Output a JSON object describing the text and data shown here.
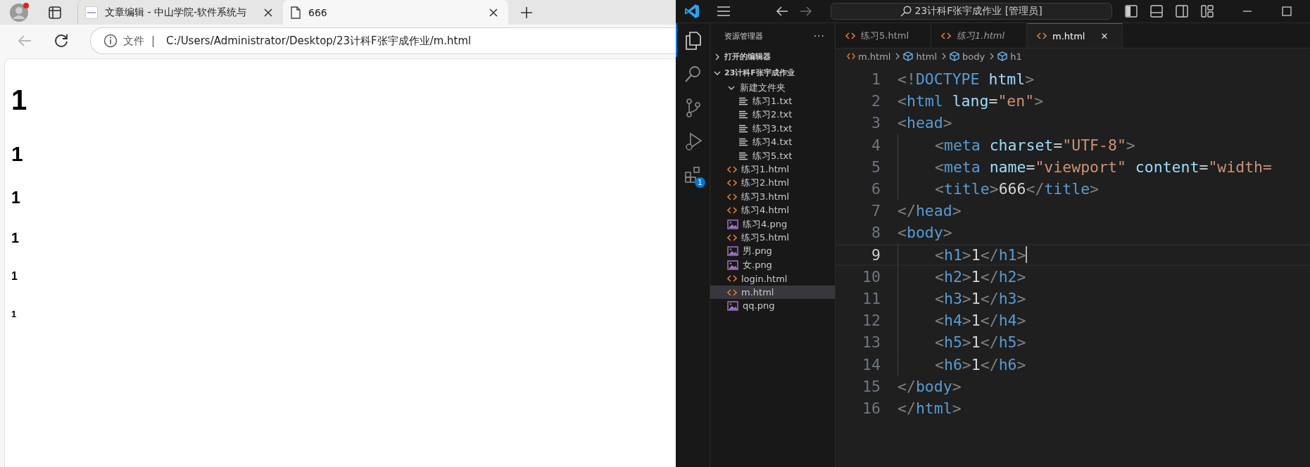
{
  "browser": {
    "tabs": [
      {
        "title": "文章编辑 - 中山学院-软件系统与",
        "kind": "site",
        "selected": false
      },
      {
        "title": "666",
        "kind": "file",
        "selected": true
      }
    ],
    "address": {
      "scheme_label": "文件",
      "separator": "|",
      "url": "C:/Users/Administrator/Desktop/23计科F张宇成作业/m.html"
    },
    "headings": [
      {
        "kind": "h1",
        "text": "1"
      },
      {
        "kind": "h2",
        "text": "1"
      },
      {
        "kind": "h3",
        "text": "1"
      },
      {
        "kind": "h4",
        "text": "1"
      },
      {
        "kind": "h5",
        "text": "1"
      },
      {
        "kind": "h6",
        "text": "1"
      }
    ]
  },
  "vscode": {
    "title": "23计科F张宇成作业 [管理员]",
    "activity": [
      {
        "kind": "explorer",
        "selected": true
      },
      {
        "kind": "search",
        "selected": false
      },
      {
        "kind": "source-control",
        "selected": false
      },
      {
        "kind": "run-debug",
        "selected": false
      },
      {
        "kind": "extensions",
        "selected": false,
        "badge": "1"
      }
    ],
    "explorer": {
      "title": "资源管理器",
      "more": "···",
      "sections": [
        {
          "label": "打开的编辑器",
          "expanded": false
        },
        {
          "label": "23计科F张宇成作业",
          "expanded": true,
          "children": [
            {
              "label": "新建文件夹",
              "kind": "folder",
              "expanded": true,
              "selected": false,
              "children": [
                {
                  "label": "练习1.txt",
                  "kind": "txt",
                  "selected": false
                },
                {
                  "label": "练习2.txt",
                  "kind": "txt",
                  "selected": false
                },
                {
                  "label": "练习3.txt",
                  "kind": "txt",
                  "selected": false
                },
                {
                  "label": "练习4.txt",
                  "kind": "txt",
                  "selected": false
                },
                {
                  "label": "练习5.txt",
                  "kind": "txt",
                  "selected": false
                }
              ]
            },
            {
              "label": "练习1.html",
              "kind": "html",
              "selected": false
            },
            {
              "label": "练习2.html",
              "kind": "html",
              "selected": false
            },
            {
              "label": "练习3.html",
              "kind": "html",
              "selected": false
            },
            {
              "label": "练习4.html",
              "kind": "html",
              "selected": false
            },
            {
              "label": "练习4.png",
              "kind": "png",
              "selected": false
            },
            {
              "label": "练习5.html",
              "kind": "html",
              "selected": false
            },
            {
              "label": "男.png",
              "kind": "png",
              "selected": false
            },
            {
              "label": "女.png",
              "kind": "png",
              "selected": false
            },
            {
              "label": "login.html",
              "kind": "html",
              "selected": false
            },
            {
              "label": "m.html",
              "kind": "html",
              "selected": true
            },
            {
              "label": "qq.png",
              "kind": "png",
              "selected": false
            }
          ]
        }
      ]
    },
    "tabs": [
      {
        "label": "练习5.html",
        "preview": false,
        "selected": false
      },
      {
        "label": "练习1.html",
        "preview": true,
        "selected": false
      },
      {
        "label": "m.html",
        "preview": false,
        "selected": true,
        "close": "✕"
      }
    ],
    "breadcrumb": [
      {
        "label": "m.html",
        "kind": "file"
      },
      {
        "label": "html",
        "kind": "symbol"
      },
      {
        "label": "body",
        "kind": "symbol"
      },
      {
        "label": "h1",
        "kind": "symbol"
      }
    ],
    "code": [
      {
        "number": "1",
        "current": false,
        "tokens": [
          {
            "kind": "punct",
            "text": "<!"
          },
          {
            "kind": "tag",
            "text": "DOCTYPE"
          },
          {
            "kind": "attr",
            "text": " html"
          },
          {
            "kind": "punct",
            "text": ">"
          }
        ]
      },
      {
        "number": "2",
        "current": false,
        "tokens": [
          {
            "kind": "punct",
            "text": "<"
          },
          {
            "kind": "tag",
            "text": "html"
          },
          {
            "kind": "attr",
            "text": " lang"
          },
          {
            "kind": "text",
            "text": "="
          },
          {
            "kind": "string",
            "text": "\"en\""
          },
          {
            "kind": "punct",
            "text": ">"
          }
        ]
      },
      {
        "number": "3",
        "current": false,
        "tokens": [
          {
            "kind": "punct",
            "text": "<"
          },
          {
            "kind": "tag",
            "text": "head"
          },
          {
            "kind": "punct",
            "text": ">"
          }
        ]
      },
      {
        "number": "4",
        "current": false,
        "indented": true,
        "tokens": [
          {
            "kind": "punct",
            "text": "<"
          },
          {
            "kind": "tag",
            "text": "meta"
          },
          {
            "kind": "attr",
            "text": " charset"
          },
          {
            "kind": "text",
            "text": "="
          },
          {
            "kind": "string",
            "text": "\"UTF-8\""
          },
          {
            "kind": "punct",
            "text": ">"
          }
        ]
      },
      {
        "number": "5",
        "current": false,
        "indented": true,
        "tokens": [
          {
            "kind": "punct",
            "text": "<"
          },
          {
            "kind": "tag",
            "text": "meta"
          },
          {
            "kind": "attr",
            "text": " name"
          },
          {
            "kind": "text",
            "text": "="
          },
          {
            "kind": "string",
            "text": "\"viewport\""
          },
          {
            "kind": "attr",
            "text": " content"
          },
          {
            "kind": "text",
            "text": "="
          },
          {
            "kind": "string",
            "text": "\"width="
          }
        ]
      },
      {
        "number": "6",
        "current": false,
        "indented": true,
        "tokens": [
          {
            "kind": "punct",
            "text": "<"
          },
          {
            "kind": "tag",
            "text": "title"
          },
          {
            "kind": "punct",
            "text": ">"
          },
          {
            "kind": "text",
            "text": "666"
          },
          {
            "kind": "punct",
            "text": "</"
          },
          {
            "kind": "tag",
            "text": "title"
          },
          {
            "kind": "punct",
            "text": ">"
          }
        ]
      },
      {
        "number": "7",
        "current": false,
        "tokens": [
          {
            "kind": "punct",
            "text": "</"
          },
          {
            "kind": "tag",
            "text": "head"
          },
          {
            "kind": "punct",
            "text": ">"
          }
        ]
      },
      {
        "number": "8",
        "current": false,
        "tokens": [
          {
            "kind": "punct",
            "text": "<"
          },
          {
            "kind": "tag",
            "text": "body"
          },
          {
            "kind": "punct",
            "text": ">"
          }
        ]
      },
      {
        "number": "9",
        "current": true,
        "indented": true,
        "tokens": [
          {
            "kind": "punct",
            "text": "<"
          },
          {
            "kind": "tag",
            "text": "h1"
          },
          {
            "kind": "punct",
            "text": ">"
          },
          {
            "kind": "text",
            "text": "1"
          },
          {
            "kind": "punct",
            "text": "</"
          },
          {
            "kind": "tag",
            "text": "h1"
          },
          {
            "kind": "punct",
            "text": ">"
          }
        ]
      },
      {
        "number": "10",
        "current": false,
        "indented": true,
        "tokens": [
          {
            "kind": "punct",
            "text": "<"
          },
          {
            "kind": "tag",
            "text": "h2"
          },
          {
            "kind": "punct",
            "text": ">"
          },
          {
            "kind": "text",
            "text": "1"
          },
          {
            "kind": "punct",
            "text": "</"
          },
          {
            "kind": "tag",
            "text": "h2"
          },
          {
            "kind": "punct",
            "text": ">"
          }
        ]
      },
      {
        "number": "11",
        "current": false,
        "indented": true,
        "tokens": [
          {
            "kind": "punct",
            "text": "<"
          },
          {
            "kind": "tag",
            "text": "h3"
          },
          {
            "kind": "punct",
            "text": ">"
          },
          {
            "kind": "text",
            "text": "1"
          },
          {
            "kind": "punct",
            "text": "</"
          },
          {
            "kind": "tag",
            "text": "h3"
          },
          {
            "kind": "punct",
            "text": ">"
          }
        ]
      },
      {
        "number": "12",
        "current": false,
        "indented": true,
        "tokens": [
          {
            "kind": "punct",
            "text": "<"
          },
          {
            "kind": "tag",
            "text": "h4"
          },
          {
            "kind": "punct",
            "text": ">"
          },
          {
            "kind": "text",
            "text": "1"
          },
          {
            "kind": "punct",
            "text": "</"
          },
          {
            "kind": "tag",
            "text": "h4"
          },
          {
            "kind": "punct",
            "text": ">"
          }
        ]
      },
      {
        "number": "13",
        "current": false,
        "indented": true,
        "tokens": [
          {
            "kind": "punct",
            "text": "<"
          },
          {
            "kind": "tag",
            "text": "h5"
          },
          {
            "kind": "punct",
            "text": ">"
          },
          {
            "kind": "text",
            "text": "1"
          },
          {
            "kind": "punct",
            "text": "</"
          },
          {
            "kind": "tag",
            "text": "h5"
          },
          {
            "kind": "punct",
            "text": ">"
          }
        ]
      },
      {
        "number": "14",
        "current": false,
        "indented": true,
        "tokens": [
          {
            "kind": "punct",
            "text": "<"
          },
          {
            "kind": "tag",
            "text": "h6"
          },
          {
            "kind": "punct",
            "text": ">"
          },
          {
            "kind": "text",
            "text": "1"
          },
          {
            "kind": "punct",
            "text": "</"
          },
          {
            "kind": "tag",
            "text": "h6"
          },
          {
            "kind": "punct",
            "text": ">"
          }
        ]
      },
      {
        "number": "15",
        "current": false,
        "tokens": [
          {
            "kind": "punct",
            "text": "</"
          },
          {
            "kind": "tag",
            "text": "body"
          },
          {
            "kind": "punct",
            "text": ">"
          }
        ]
      },
      {
        "number": "16",
        "current": false,
        "tokens": [
          {
            "kind": "punct",
            "text": "</"
          },
          {
            "kind": "tag",
            "text": "html"
          },
          {
            "kind": "punct",
            "text": ">"
          }
        ]
      }
    ]
  }
}
